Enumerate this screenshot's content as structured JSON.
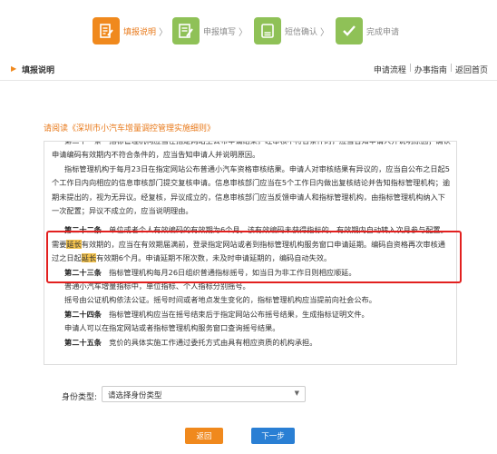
{
  "steps": [
    {
      "label": "填报说明",
      "state": "active",
      "icon": "edit-icon"
    },
    {
      "label": "申报填写",
      "state": "inactive",
      "icon": "form-edit-icon"
    },
    {
      "label": "短信确认",
      "state": "inactive",
      "icon": "message-icon"
    },
    {
      "label": "完成申请",
      "state": "inactive",
      "icon": "check-icon"
    }
  ],
  "step_arrow": "〉",
  "header": {
    "caret": "▶",
    "title": "填报说明",
    "links": [
      "申请流程",
      "办事指南",
      "返回首页"
    ],
    "sep": "|"
  },
  "read_note": "请阅读《深圳市小汽车增量调控管理实施细则》",
  "doc": {
    "p0": "第二十一条　指标管理机构应当在指定网站上公布申请结果，经审核不符合条件的，应当告知申请人并说明原因；确认申请编码有效期内不符合条件的，应当告知申请人并说明原因。",
    "p1": "指标管理机构于每月23日在指定网站公布普通小汽车资格审核结果。申请人对审核结果有异议的，应当自公布之日起5个工作日内向相应的信息审核部门提交复核申请。信息审核部门应当在5个工作日内做出复核结论并告知指标管理机构；逾期未提出的，视为无异议。经复核，异议成立的，信息审核部门应当反馈申请人和指标管理机构，由指标管理机构纳入下一次配置；异议不成立的，应当说明理由。",
    "p2_head": "第二十二条",
    "p2_a": "　单位或者个人有效编码的有效期为6个月。该有效编码未获得指标的，有效期内自动转入次月参与配置。需要",
    "p2_mark1": "延长",
    "p2_b": "有效期的，应当在有效期届满前，登录指定网站或者到指标管理机构服务窗口申请延期。编码自资格再次审核通过之日起",
    "p2_mark2": "延长",
    "p2_c": "有效期6个月。申请延期不限次数，未及时申请延期的，编码自动失效。",
    "p3_head": "第二十三条",
    "p3": "　指标管理机构每月26日组织普通指标摇号，如当日为非工作日则相应顺延。",
    "p4": "普通小汽车增量指标中，单位指标、个人指标分别摇号。",
    "p5": "摇号由公证机构依法公证。摇号时间或者地点发生变化的，指标管理机构应当提前向社会公布。",
    "p6_head": "第二十四条",
    "p6": "　指标管理机构应当在摇号结束后于指定网站公布摇号结果，生成指标证明文件。",
    "p7": "申请人可以在指定网站或者指标管理机构服务窗口查询摇号结果。",
    "p8_head": "第二十五条",
    "p8": "　竞价的具体实施工作通过委托方式由具有相应资质的机构承担。"
  },
  "form": {
    "id_type_label": "身份类型:",
    "id_type_placeholder": "请选择身份类型",
    "dropdown_arrow": "▼"
  },
  "buttons": {
    "back": "返回",
    "next": "下一步"
  },
  "colors": {
    "accent": "#f0891d",
    "step_inactive": "#8fc157",
    "primary": "#2a7fd4",
    "highlight_box": "#e2201f",
    "text_mark": "#f2c24e"
  }
}
